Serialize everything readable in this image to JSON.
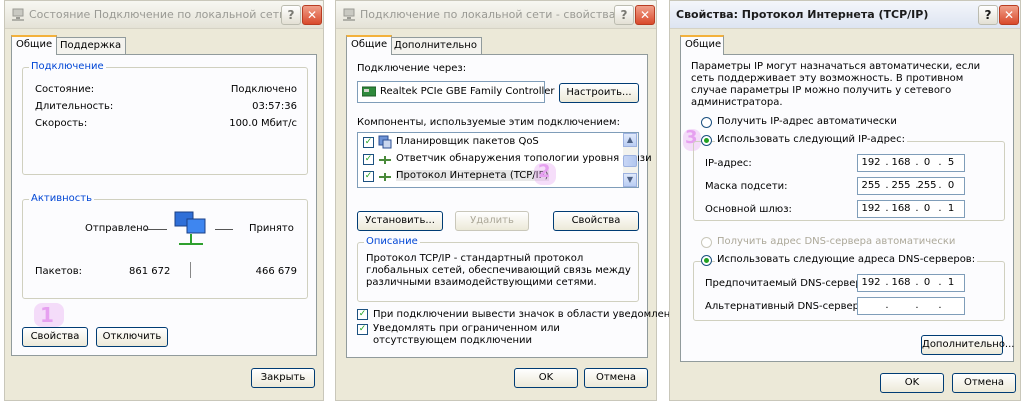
{
  "colors": {
    "accent": "#0046d5",
    "marker": "#e6a0f0",
    "check": "#21a121"
  },
  "status_window": {
    "title": "Состояние Подключение по локальной сети",
    "tabs": [
      "Общие",
      "Поддержка"
    ],
    "connection": {
      "legend": "Подключение",
      "rows": [
        {
          "label": "Состояние:",
          "value": "Подключено"
        },
        {
          "label": "Длительность:",
          "value": "03:57:36"
        },
        {
          "label": "Скорость:",
          "value": "100.0 Мбит/с"
        }
      ]
    },
    "activity": {
      "legend": "Активность",
      "sent_label": "Отправлено",
      "received_label": "Принято",
      "packets_label": "Пакетов:",
      "packets_sent": "861 672",
      "packets_received": "466 679"
    },
    "properties_button": "Свойства",
    "disable_button": "Отключить",
    "close_button": "Закрыть",
    "marker": "1"
  },
  "props_window": {
    "title": "Подключение по локальной сети - свойства",
    "tabs": [
      "Общие",
      "Дополнительно"
    ],
    "connect_using_label": "Подключение через:",
    "adapter_name": "Realtek PCIe GBE Family Controller",
    "configure_button": "Настроить...",
    "components_label": "Компоненты, используемые этим подключением:",
    "components": [
      "Планировщик пакетов QoS",
      "Ответчик обнаружения топологии уровня связи",
      "Протокол Интернета (TCP/IP)"
    ],
    "install_button": "Установить...",
    "uninstall_button": "Удалить",
    "properties_button": "Свойства",
    "description_legend": "Описание",
    "description_text": "Протокол TCP/IP - стандартный протокол глобальных сетей, обеспечивающий связь между различными взаимодействующими сетями.",
    "show_icon_label": "При подключении вывести значок в области уведомлений",
    "notify_label": "Уведомлять при ограниченном или отсутствующем подключении",
    "ok_button": "OK",
    "cancel_button": "Отмена",
    "marker": "2"
  },
  "tcpip_window": {
    "title": "Свойства: Протокол Интернета (TCP/IP)",
    "tab": "Общие",
    "info_text": "Параметры IP могут назначаться автоматически, если сеть поддерживает эту возможность. В противном случае параметры IP можно получить у сетевого администратора.",
    "auto_ip_label": "Получить IP-адрес автоматически",
    "manual_ip_label": "Использовать следующий IP-адрес:",
    "ip_label": "IP-адрес:",
    "ip": [
      "192",
      "168",
      "0",
      "5"
    ],
    "mask_label": "Маска подсети:",
    "mask": [
      "255",
      "255",
      "255",
      "0"
    ],
    "gateway_label": "Основной шлюз:",
    "gateway": [
      "192",
      "168",
      "0",
      "1"
    ],
    "auto_dns_label": "Получить адрес DNS-сервера автоматически",
    "manual_dns_label": "Использовать следующие адреса DNS-серверов:",
    "preferred_dns_label": "Предпочитаемый DNS-сервер:",
    "preferred_dns": [
      "192",
      "168",
      "0",
      "1"
    ],
    "alt_dns_label": "Альтернативный DNS-сервер:",
    "advanced_button": "Дополнительно...",
    "ok_button": "OK",
    "cancel_button": "Отмена",
    "marker": "3"
  }
}
